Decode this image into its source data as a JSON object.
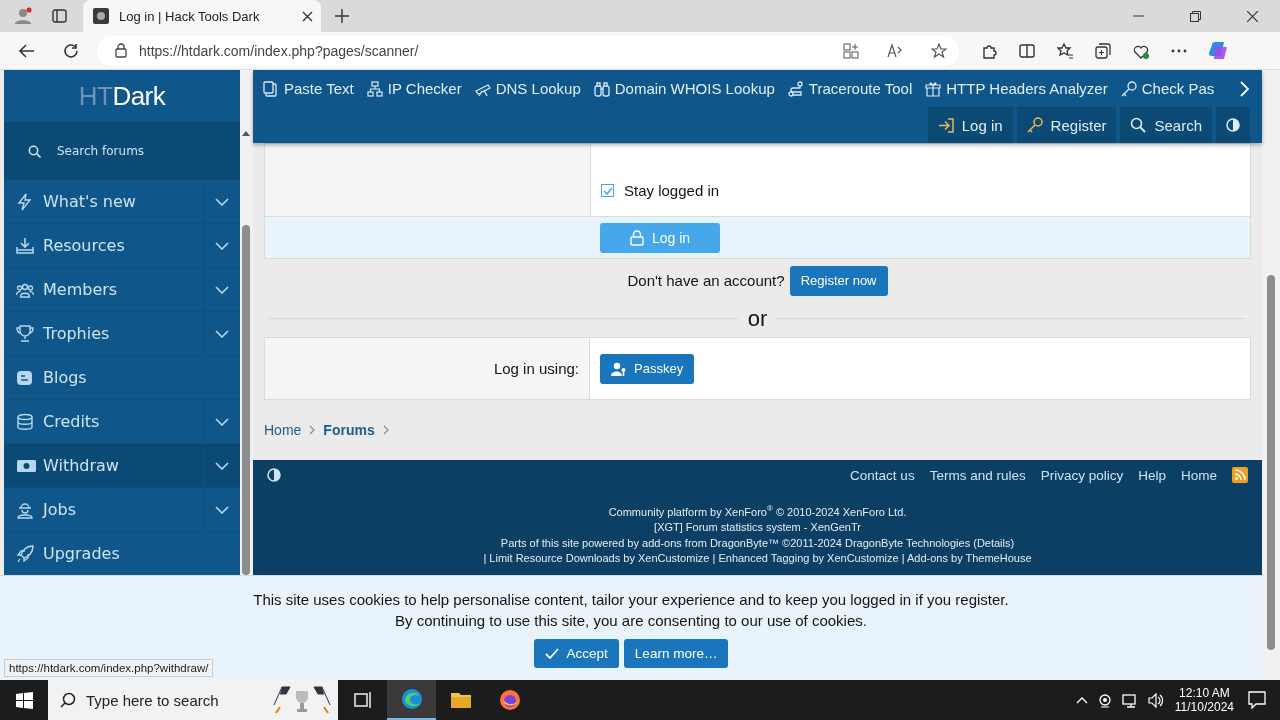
{
  "browser": {
    "tabs": [
      {
        "title": "Log in | Hack Tools Dark",
        "selected": true
      }
    ],
    "url": "https://htdark.com/index.php?pages/scanner/"
  },
  "sidebar": {
    "logo": {
      "light": "HT",
      "bold": "Dark"
    },
    "sub_items": [
      "Search forums"
    ],
    "items": [
      {
        "label": "What's new",
        "expandable": true,
        "highlighted": false
      },
      {
        "label": "Resources",
        "expandable": true,
        "highlighted": false
      },
      {
        "label": "Members",
        "expandable": true,
        "highlighted": false
      },
      {
        "label": "Trophies",
        "expandable": true,
        "highlighted": false
      },
      {
        "label": "Blogs",
        "expandable": false,
        "highlighted": false
      },
      {
        "label": "Credits",
        "expandable": true,
        "highlighted": false
      },
      {
        "label": "Withdraw",
        "expandable": true,
        "highlighted": true
      },
      {
        "label": "Jobs",
        "expandable": true,
        "highlighted": false
      },
      {
        "label": "Upgrades",
        "expandable": false,
        "highlighted": false
      }
    ]
  },
  "nav": {
    "tools": [
      "Paste Text",
      "IP Checker",
      "DNS Lookup",
      "Domain WHOIS Lookup",
      "Traceroute Tool",
      "HTTP Headers Analyzer",
      "Check Pas"
    ],
    "user_links": [
      "Log in",
      "Register",
      "Search"
    ]
  },
  "form": {
    "stay_logged_in": {
      "label": "Stay logged in",
      "checked": true
    },
    "login_button": "Log in",
    "register_prompt": "Don't have an account?",
    "register_button": "Register now",
    "divider": "or",
    "alt_label": "Log in using:",
    "passkey_button": "Passkey"
  },
  "breadcrumbs": [
    {
      "label": "Home",
      "current": false
    },
    {
      "label": "Forums",
      "current": true
    }
  ],
  "footer": {
    "links": [
      "Contact us",
      "Terms and rules",
      "Privacy policy",
      "Help",
      "Home"
    ],
    "credits": [
      "Community platform by XenForo$^{®}$ © 2010-2024 XenForo Ltd.",
      "[XGT] Forum statistics system - XenGenTr",
      "Parts of this site powered by add-ons from DragonByte™ ©2011-2024 DragonByte Technologies (Details)",
      "| Limit Resource Downloads by XenCustomize | Enhanced Tagging by XenCustomize | Add-ons by ThemeHouse"
    ]
  },
  "cookie_notice": {
    "lines": [
      "This site uses cookies to help personalise content, tailor your experience and to keep you logged in if you register.",
      "By continuing to use this site, you are consenting to our use of cookies."
    ],
    "accept": "Accept",
    "learn_more": "Learn more…"
  },
  "status_url": "https://htdark.com/index.php?withdraw/",
  "taskbar": {
    "search_placeholder": "Type here to search",
    "apps": [
      {
        "kind": "taskview",
        "selected": false
      },
      {
        "kind": "edge",
        "selected": true
      },
      {
        "kind": "explorer",
        "selected": false
      },
      {
        "kind": "firefox",
        "selected": false
      }
    ],
    "time": "12:10 AM",
    "date": "11/10/2024"
  }
}
